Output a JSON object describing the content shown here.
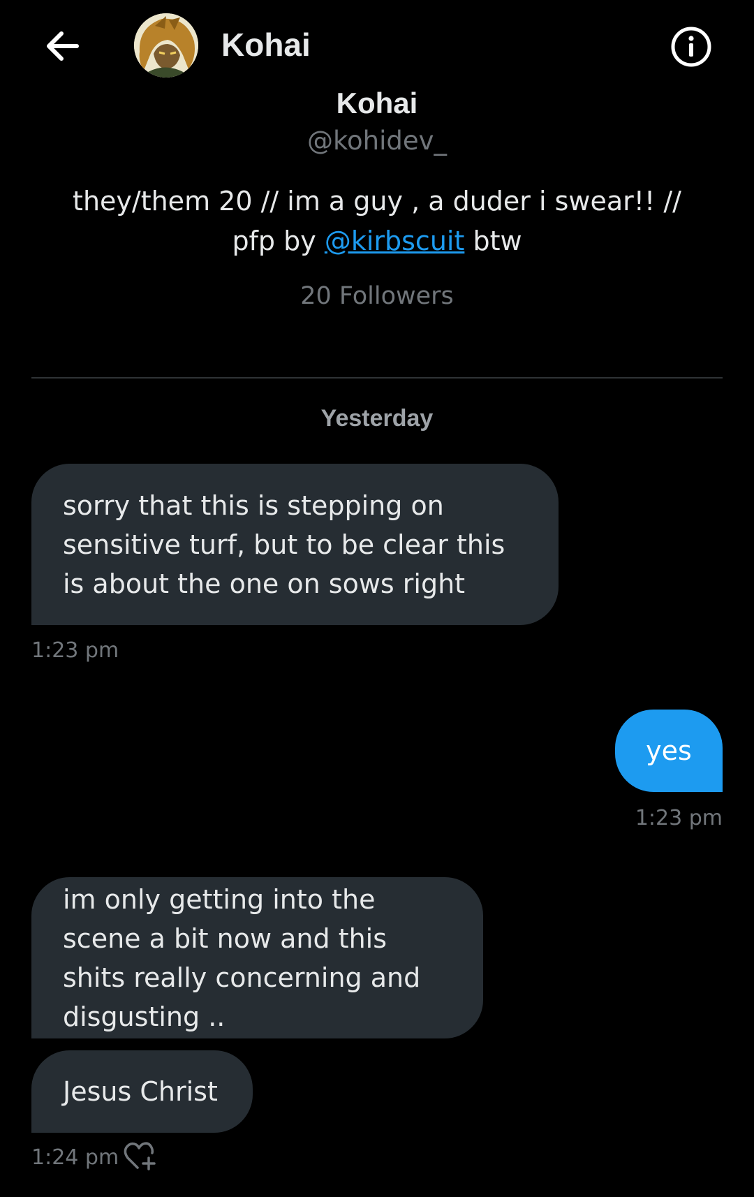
{
  "header": {
    "title": "Kohai",
    "back_icon": "arrow-left-icon",
    "info_icon": "info-circle-icon"
  },
  "profile": {
    "name": "Kohai",
    "handle": "@kohidev_",
    "bio_before": "they/them 20 // im a guy , a duder i swear!! // pfp by ",
    "bio_link": "@kirbscuit",
    "bio_after": " btw",
    "followers": "20 Followers"
  },
  "date_separator": "Yesterday",
  "messages": [
    {
      "direction": "incoming",
      "text": "sorry that this is stepping on sensitive turf, but to be clear this is about the one on sows right",
      "time": "1:23 pm"
    },
    {
      "direction": "outgoing",
      "text": "yes",
      "time": "1:23 pm"
    },
    {
      "direction": "incoming",
      "text": "im only getting into the scene a bit now and this shits really concerning and disgusting ..",
      "time": ""
    },
    {
      "direction": "incoming",
      "text": "Jesus Christ",
      "time": "1:24 pm"
    }
  ],
  "react_icon": "heart-plus-icon",
  "colors": {
    "background": "#000000",
    "incoming_bubble": "#262d33",
    "outgoing_bubble": "#1d9bf0",
    "link": "#1d9bf0",
    "muted_text": "#71767b"
  }
}
